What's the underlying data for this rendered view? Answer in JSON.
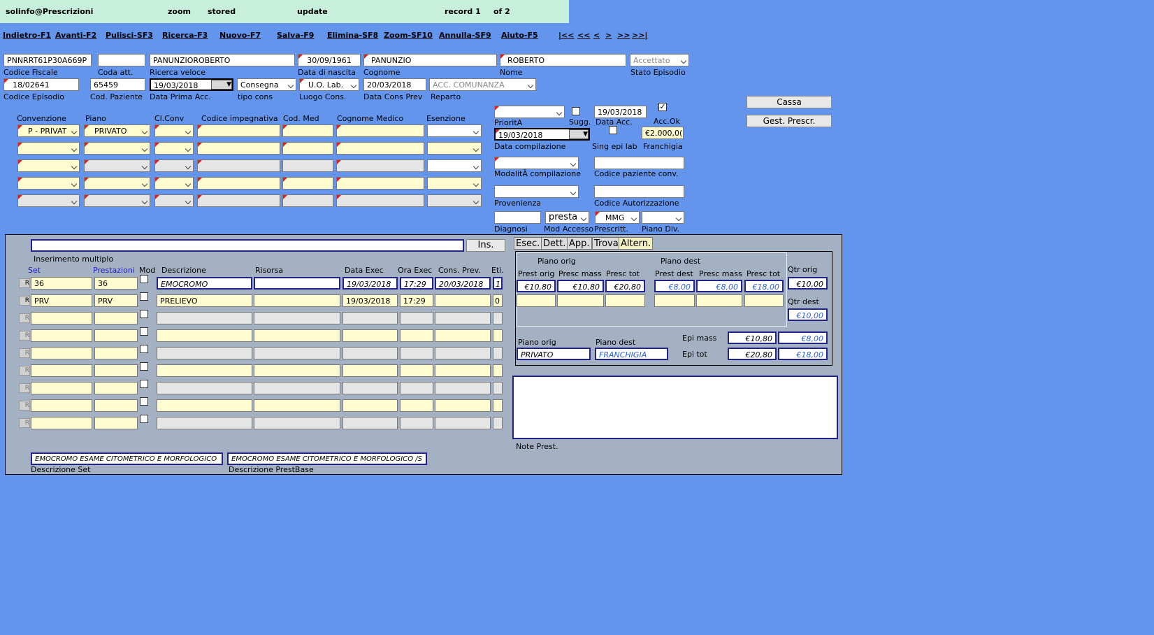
{
  "topbar": {
    "user": "solinfo@Prescrizioni",
    "zoom": "zoom",
    "stored": "stored",
    "update": "update",
    "record": "record 1",
    "of": "of 2"
  },
  "menu": [
    "Indietro-F1",
    "Avanti-F2",
    "Pulisci-SF3",
    "Ricerca-F3",
    "Nuovo-F7",
    "Salva-F9",
    "Elimina-SF8",
    "Zoom-SF10",
    "Annulla-SF9",
    "Aiuto-F5",
    "|<<",
    "<<",
    "<",
    ">",
    ">>",
    ">>|"
  ],
  "patient": {
    "codice_fiscale": "PNNRRT61P30A669P",
    "codice_fiscale_label": "Codice Fiscale",
    "coda_att": "",
    "coda_att_label": "Coda att.",
    "ricerca_veloce": "PANUNZIOROBERTO",
    "ricerca_veloce_label": "Ricerca veloce",
    "data_nascita": "30/09/1961",
    "data_nascita_label": "Data di nascita",
    "cognome": "PANUNZIO",
    "cognome_label": "Cognome",
    "nome": "ROBERTO",
    "nome_label": "Nome",
    "stato_episodio": "Accettato",
    "stato_episodio_label": "Stato Episodio",
    "codice_episodio": "18/02641",
    "codice_episodio_label": "Codice Episodio",
    "cod_paziente": "65459",
    "cod_paziente_label": "Cod. Paziente",
    "data_prima_acc": "19/03/2018",
    "data_prima_acc_label": "Data Prima Acc.",
    "tipo_cons": "Consegna",
    "tipo_cons_label": "tipo cons",
    "luogo_cons": "U.O. Lab.",
    "luogo_cons_label": "Luogo Cons.",
    "data_cons_prev": "20/03/2018",
    "data_cons_prev_label": "Data Cons Prev",
    "reparto": "ACC. COMUNANZA",
    "reparto_label": "Reparto"
  },
  "buttons": {
    "cassa": "Cassa",
    "gest_prescr": "Gest. Prescr.",
    "ins": "Ins."
  },
  "conv": {
    "headers": [
      "Convenzione",
      "Piano",
      "Cl.Conv",
      "Codice impegnativa",
      "Cod. Med",
      "Cognome Medico",
      "Esenzione"
    ],
    "row1": {
      "convenzione": "P - PRIVAT",
      "piano": "PRIVATO"
    }
  },
  "right": {
    "priorita_label": "PrioritA",
    "sugg_label": "Sugg.",
    "data_acc": "19/03/2018",
    "data_acc_label": "Data Acc.",
    "acc_ok_label": "Acc.Ok",
    "data_compilazione": "19/03/2018",
    "data_compilazione_label": "Data compilazione",
    "sing_epi_lab_label": "Sing epi lab",
    "franchigia": "€2.000,0(",
    "franchigia_label": "Franchigia",
    "modalita_label": "ModalitÃ  compilazione",
    "codice_paziente_conv_label": "Codice paziente conv.",
    "provenienza_label": "Provenienza",
    "codice_autorizzazione_label": "Codice Autorizzazione",
    "diagnosi_label": "Diagnosi",
    "mod_accesso": "presta",
    "mod_accesso_label": "Mod Accesso",
    "prescritt": "MMG",
    "prescritt_label": "Prescritt.",
    "piano_div_label": "Piano Div."
  },
  "grid": {
    "inserimento_label": "Inserimento multiplo",
    "headers": [
      "Set",
      "Prestazioni",
      "Mod",
      "Descrizione",
      "Risorsa",
      "Data Exec",
      "Ora Exec",
      "Cons. Prev.",
      "Eti."
    ],
    "rows": [
      {
        "r": "R",
        "set": "36",
        "prest": "36",
        "descr": "EMOCROMO",
        "risorsa": "",
        "data": "19/03/2018",
        "ora": "17:29",
        "cons": "20/03/2018",
        "eti": "1"
      },
      {
        "r": "R",
        "set": "PRV",
        "prest": "PRV",
        "descr": "PRELIEVO",
        "risorsa": "",
        "data": "19/03/2018",
        "ora": "17:29",
        "cons": "",
        "eti": "0"
      }
    ],
    "descr_set": "EMOCROMO ESAME CITOMETRICO E MORFOLOGICO",
    "descr_set_label": "Descrizione Set",
    "descr_prestbase": "EMOCROMO ESAME CITOMETRICO E MORFOLOGICO /S",
    "descr_prestbase_label": "Descrizione PrestBase"
  },
  "tabs": [
    "Esec.",
    "Dett.",
    "App.",
    "Trova",
    "Altern."
  ],
  "altern": {
    "piano_orig_label": "Piano orig",
    "piano_dest_label": "Piano dest",
    "headers": [
      "Prest orig",
      "Presc mass",
      "Presc tot",
      "Prest dest",
      "Presc mass",
      "Presc tot"
    ],
    "row": [
      "€10,80",
      "€10,80",
      "€20,80",
      "€8,00",
      "€8,00",
      "€18,00"
    ],
    "qtr_orig_label": "Qtr orig",
    "qtr_orig": "€10,00",
    "qtr_dest_label": "Qtr dest",
    "qtr_dest": "€10,00",
    "piano_orig": "PRIVATO",
    "piano_dest": "FRANCHIGIA",
    "epi_mass_label": "Epi mass",
    "epi_mass_orig": "€10,80",
    "epi_mass_dest": "€8,00",
    "epi_tot_label": "Epi tot",
    "epi_tot_orig": "€20,80",
    "epi_tot_dest": "€18,00",
    "note_label": "Note Prest."
  }
}
